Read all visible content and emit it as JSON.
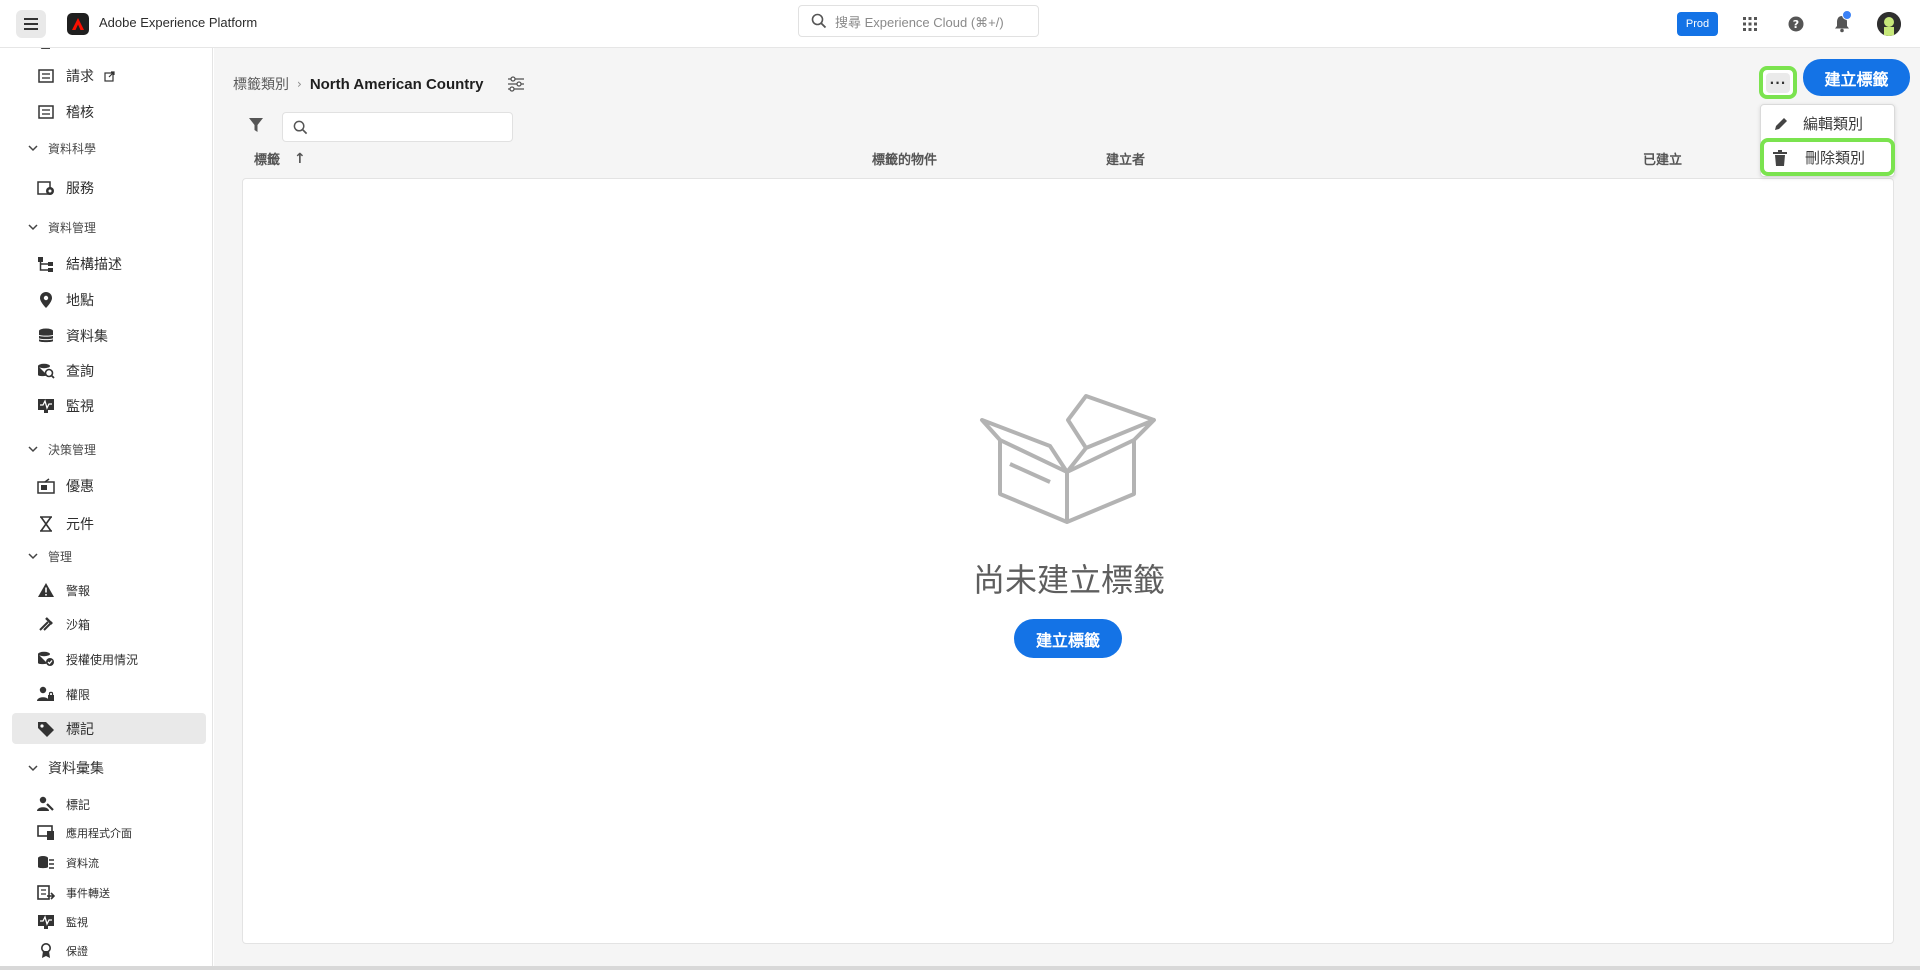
{
  "app": {
    "title": "Adobe Experience Platform",
    "search_placeholder": "搜尋 Experience Cloud (⌘+/)",
    "env_badge": "Prod"
  },
  "sidebar": {
    "items": [
      {
        "label": "請求",
        "icon": "request-icon"
      },
      {
        "label": "稽核",
        "icon": "audit-icon"
      },
      {
        "section": "資料科學"
      },
      {
        "label": "服務",
        "icon": "service-gear-icon"
      },
      {
        "section": "資料管理"
      },
      {
        "label": "結構描述",
        "icon": "schema-icon"
      },
      {
        "label": "地點",
        "icon": "location-pin-icon"
      },
      {
        "label": "資料集",
        "icon": "database-icon"
      },
      {
        "label": "查詢",
        "icon": "query-icon"
      },
      {
        "label": "監視",
        "icon": "monitor-icon"
      },
      {
        "section": "決策管理"
      },
      {
        "label": "優惠",
        "icon": "offer-icon"
      },
      {
        "label": "元件",
        "icon": "component-icon"
      },
      {
        "section": "管理"
      },
      {
        "label": "警報",
        "icon": "alert-icon"
      },
      {
        "label": "沙箱",
        "icon": "sandbox-icon"
      },
      {
        "label": "授權使用情況",
        "icon": "license-icon"
      },
      {
        "label": "權限",
        "icon": "permission-icon"
      },
      {
        "label": "標記",
        "icon": "tag-icon",
        "active": true
      },
      {
        "section": "資料彙集"
      },
      {
        "label": "標記",
        "icon": "tags-user-icon"
      },
      {
        "label": "應用程式介面",
        "icon": "app-surface-icon"
      },
      {
        "label": "資料流",
        "icon": "datastream-icon"
      },
      {
        "label": "事件轉送",
        "icon": "event-forwarding-icon"
      },
      {
        "label": "監視",
        "icon": "monitor-icon"
      },
      {
        "label": "保證",
        "icon": "assurance-icon"
      }
    ]
  },
  "breadcrumb": {
    "parent": "標籤類別",
    "separator": "›",
    "current": "North American Country"
  },
  "table": {
    "columns": [
      "標籤",
      "標籤的物件",
      "建立者",
      "已建立"
    ],
    "sort_indicator": "↑"
  },
  "empty_state": {
    "message": "尚未建立標籤",
    "button": "建立標籤"
  },
  "actions": {
    "more": "...",
    "primary": "建立標籤"
  },
  "dropdown": {
    "items": [
      {
        "label": "編輯類別",
        "icon": "pencil-icon"
      },
      {
        "label": "刪除類別",
        "icon": "trash-icon"
      }
    ]
  },
  "colors": {
    "accent": "#1473e6",
    "highlight": "#7be34f"
  }
}
